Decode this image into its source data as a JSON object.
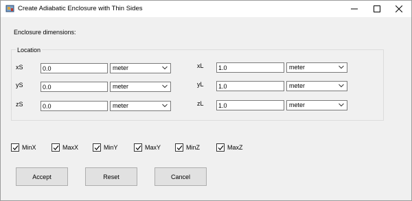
{
  "window": {
    "title": "Create Adiabatic Enclosure with Thin Sides",
    "icon": "app-icon",
    "controls": [
      "minimize-icon",
      "maximize-icon",
      "close-icon"
    ]
  },
  "enclosure_label": "Enclosure dimensions:",
  "location_group": {
    "legend": "Location",
    "fields": {
      "xS": {
        "label": "xS",
        "value": "0.0",
        "unit": "meter"
      },
      "yS": {
        "label": "yS",
        "value": "0.0",
        "unit": "meter"
      },
      "zS": {
        "label": "zS",
        "value": "0.0",
        "unit": "meter"
      },
      "xL": {
        "label": "xL",
        "value": "1.0",
        "unit": "meter"
      },
      "yL": {
        "label": "yL",
        "value": "1.0",
        "unit": "meter"
      },
      "zL": {
        "label": "zL",
        "value": "1.0",
        "unit": "meter"
      }
    }
  },
  "sides": [
    {
      "label": "MinX",
      "checked": true
    },
    {
      "label": "MaxX",
      "checked": true
    },
    {
      "label": "MinY",
      "checked": true
    },
    {
      "label": "MaxY",
      "checked": true
    },
    {
      "label": "MinZ",
      "checked": true
    },
    {
      "label": "MaxZ",
      "checked": true
    }
  ],
  "buttons": {
    "accept": "Accept",
    "reset": "Reset",
    "cancel": "Cancel"
  }
}
